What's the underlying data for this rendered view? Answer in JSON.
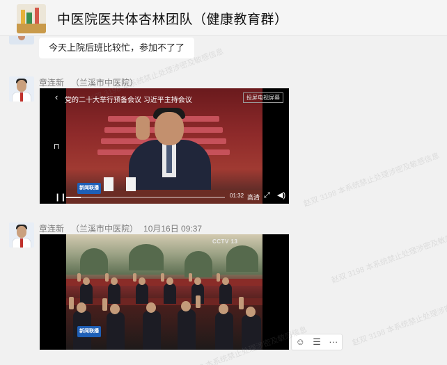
{
  "header": {
    "title": "中医院医共体杏林团队（健康教育群）"
  },
  "messages": {
    "previous_text": "今天上院后班比较忙，参加不了了",
    "m1": {
      "sender_name": "章连新",
      "sender_org": "（兰溪市中医院）",
      "video": {
        "top_text": "党的二十大举行预备会议 习近平主持会议",
        "cast_label": "投屏电视屏幕",
        "elapsed": "01:32",
        "quality": "高清",
        "progress": 0.09,
        "news_logo": "新闻联播"
      }
    },
    "m2": {
      "sender_name": "章连新",
      "sender_org": "（兰溪市中医院）",
      "time": "10月16日 09:37",
      "news_logo": "新闻联播",
      "cctv_logo": "CCTV 13"
    }
  },
  "actions": {
    "emoji_icon": "☺",
    "comment_icon": "☰",
    "more_icon": "···"
  },
  "watermarks": [
    "赵双 3198 本系统禁止处理涉密及敏感信息",
    "赵双 3198 本系统禁止处理涉密及敏感信息",
    "赵双 3198 本系统禁止处理涉密及敏感信息",
    "赵双 3198 本系统禁止处理涉密及敏感信息",
    "赵双 3198 本系统禁止处理涉密及敏感信息"
  ]
}
